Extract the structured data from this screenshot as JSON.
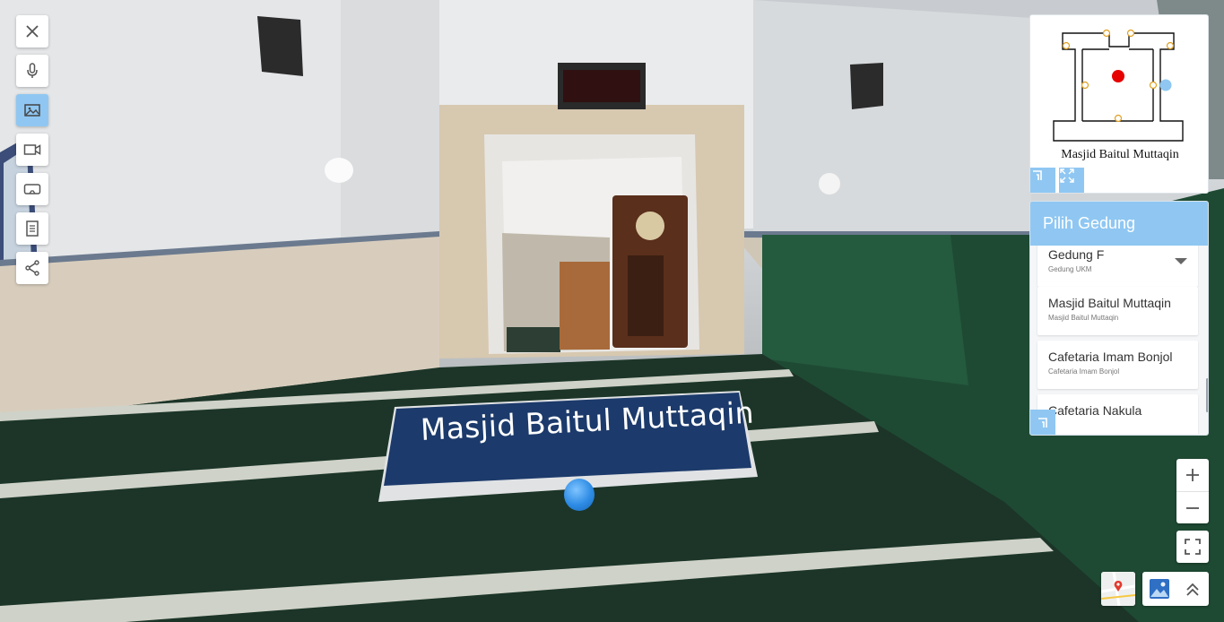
{
  "scene": {
    "label": "Masjid Baitul Muttaqin"
  },
  "toolbar": {
    "buttons": [
      {
        "icon": "close-icon"
      },
      {
        "icon": "microphone-icon"
      },
      {
        "icon": "image-icon",
        "active": true
      },
      {
        "icon": "video-icon"
      },
      {
        "icon": "vr-headset-icon"
      },
      {
        "icon": "document-icon"
      },
      {
        "icon": "share-icon"
      }
    ]
  },
  "minimap": {
    "caption": "Masjid Baitul Muttaqin"
  },
  "panel": {
    "title": "Pilih Gedung",
    "items": [
      {
        "title": "Gedung F",
        "subtitle": "Gedung UKM"
      },
      {
        "title": "Masjid Baitul Muttaqin",
        "subtitle": "Masjid Baitul Muttaqin"
      },
      {
        "title": "Cafetaria Imam Bonjol",
        "subtitle": "Cafetaria Imam Bonjol"
      },
      {
        "title": "Cafetaria Nakula",
        "subtitle": ""
      }
    ]
  },
  "colors": {
    "accent": "#8fc7f2",
    "label_bg": "#1c3a6b",
    "carpet": "#1f3a2d"
  }
}
